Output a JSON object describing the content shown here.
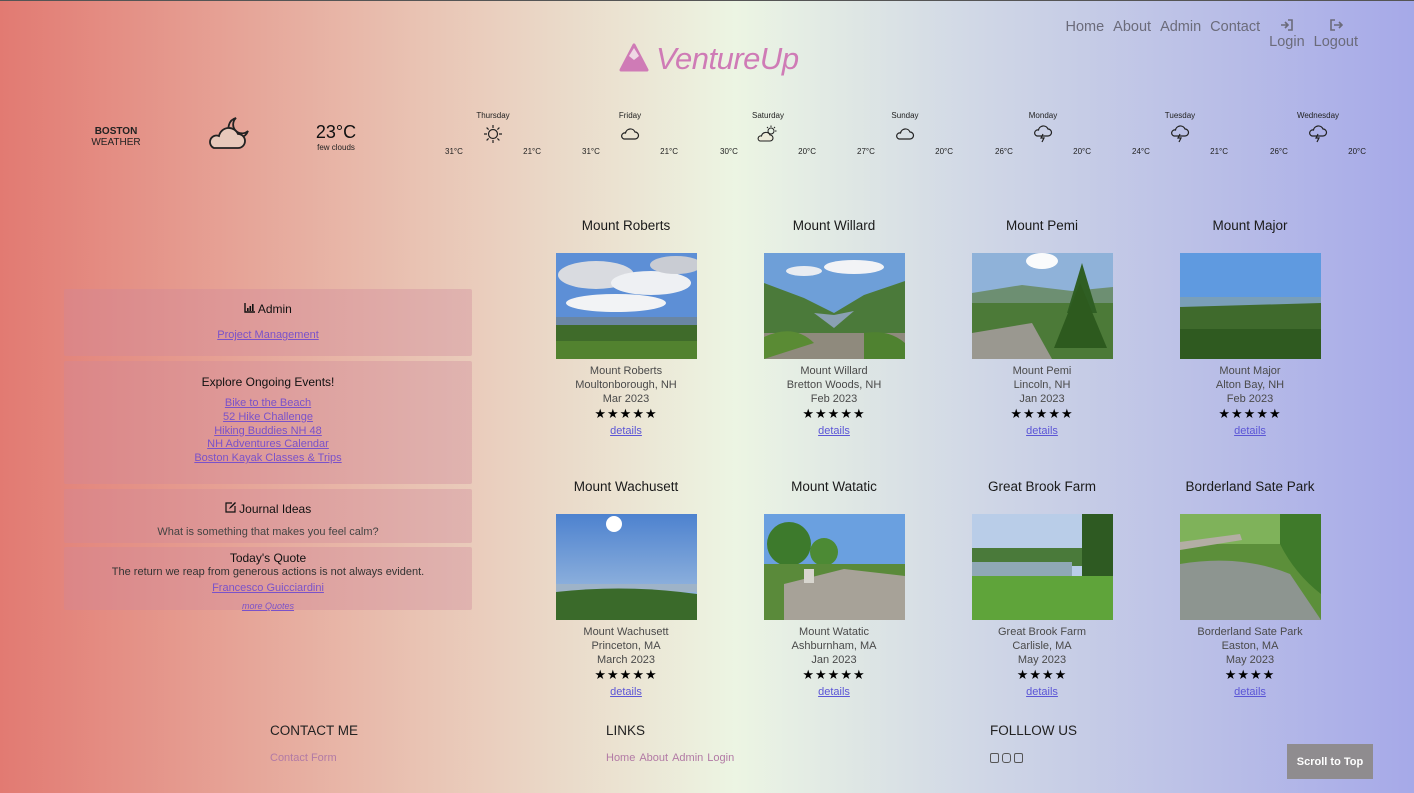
{
  "nav": {
    "items": [
      "Home",
      "About",
      "Admin",
      "Contact"
    ],
    "login": "Login",
    "logout": "Logout"
  },
  "logo": {
    "name": "VentureUp"
  },
  "weather": {
    "city": "BOSTON",
    "label": "WEATHER",
    "temp": "23°C",
    "desc": "few clouds",
    "forecast": [
      {
        "day": "Thursday",
        "icon": "sun-icon",
        "hi": "31°C",
        "lo": "21°C"
      },
      {
        "day": "Friday",
        "icon": "cloud-icon",
        "hi": "31°C",
        "lo": "21°C"
      },
      {
        "day": "Saturday",
        "icon": "sun-cloud-icon",
        "hi": "30°C",
        "lo": "20°C"
      },
      {
        "day": "Sunday",
        "icon": "cloud-icon",
        "hi": "27°C",
        "lo": "20°C"
      },
      {
        "day": "Monday",
        "icon": "thunder-cloud-icon",
        "hi": "26°C",
        "lo": "20°C"
      },
      {
        "day": "Tuesday",
        "icon": "thunder-cloud-icon",
        "hi": "24°C",
        "lo": "21°C"
      },
      {
        "day": "Wednesday",
        "icon": "thunder-cloud-icon",
        "hi": "26°C",
        "lo": "20°C"
      }
    ]
  },
  "admin_panel": {
    "title": "Admin",
    "link": "Project Management"
  },
  "events_panel": {
    "title": "Explore Ongoing Events!",
    "links": [
      "Bike to the Beach",
      "52 Hike Challenge",
      "Hiking Buddies NH 48",
      "NH Adventures Calendar",
      "Boston Kayak Classes & Trips"
    ]
  },
  "journal_panel": {
    "title": "Journal Ideas",
    "text": "What is something that makes you feel calm?"
  },
  "quote_panel": {
    "title": "Today's Quote",
    "quote": "The return we reap from generous actions is not always evident.",
    "author": "Francesco Guicciardini",
    "more": "more Quotes"
  },
  "hikes": [
    {
      "title": "Mount Roberts",
      "name": "Mount Roberts",
      "location": "Moultonborough, NH",
      "date": "Mar 2023",
      "rating": 5,
      "stars": "★★★★★",
      "details": "details"
    },
    {
      "title": "Mount Willard",
      "name": "Mount Willard",
      "location": "Bretton Woods, NH",
      "date": "Feb 2023",
      "rating": 5,
      "stars": "★★★★★",
      "details": "details"
    },
    {
      "title": "Mount Pemi",
      "name": "Mount Pemi",
      "location": "Lincoln, NH",
      "date": "Jan 2023",
      "rating": 5,
      "stars": "★★★★★",
      "details": "details"
    },
    {
      "title": "Mount Major",
      "name": "Mount Major",
      "location": "Alton Bay, NH",
      "date": "Feb 2023",
      "rating": 5,
      "stars": "★★★★★",
      "details": "details"
    },
    {
      "title": "Mount Wachusett",
      "name": "Mount Wachusett",
      "location": "Princeton, MA",
      "date": "March 2023",
      "rating": 5,
      "stars": "★★★★★",
      "details": "details"
    },
    {
      "title": "Mount Watatic",
      "name": "Mount Watatic",
      "location": "Ashburnham, MA",
      "date": "Jan 2023",
      "rating": 5,
      "stars": "★★★★★",
      "details": "details"
    },
    {
      "title": "Great Brook Farm",
      "name": "Great Brook Farm",
      "location": "Carlisle, MA",
      "date": "May 2023",
      "rating": 4,
      "stars": "★★★★",
      "details": "details"
    },
    {
      "title": "Borderland Sate Park",
      "name": "Borderland Sate Park",
      "location": "Easton, MA",
      "date": "May 2023",
      "rating": 4,
      "stars": "★★★★",
      "details": "details"
    }
  ],
  "footer": {
    "contact_heading": "CONTACT ME",
    "contact_link": "Contact Form",
    "links_heading": "LINKS",
    "links": [
      "Home",
      "About",
      "Admin",
      "Login"
    ],
    "follow_heading": "FOLLLOW US",
    "social_icons": [
      "facebook-icon",
      "instagram-icon",
      "twitter-icon"
    ]
  },
  "scroll_top": "Scroll to Top",
  "colors": {
    "brand": "#cf7bb6",
    "link": "#7a52c9"
  }
}
